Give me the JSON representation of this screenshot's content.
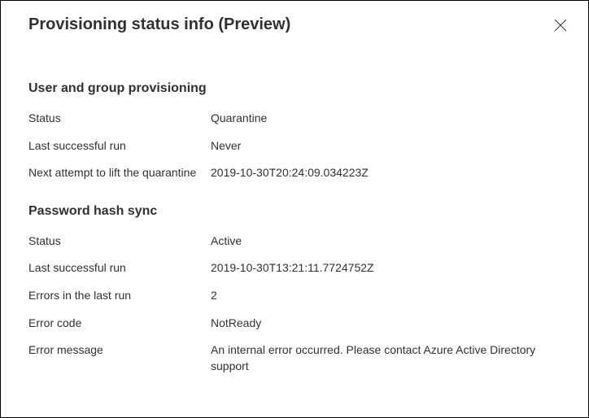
{
  "panel": {
    "title": "Provisioning status info (Preview)"
  },
  "sections": {
    "provisioning": {
      "heading": "User and group provisioning",
      "status_label": "Status",
      "status_value": "Quarantine",
      "last_run_label": "Last successful run",
      "last_run_value": "Never",
      "next_attempt_label": "Next attempt to lift the quarantine",
      "next_attempt_value": "2019-10-30T20:24:09.034223Z"
    },
    "passwordSync": {
      "heading": "Password hash sync",
      "status_label": "Status",
      "status_value": "Active",
      "last_run_label": "Last successful run",
      "last_run_value": "2019-10-30T13:21:11.7724752Z",
      "errors_label": "Errors in the last run",
      "errors_value": "2",
      "error_code_label": "Error code",
      "error_code_value": "NotReady",
      "error_message_label": "Error message",
      "error_message_value": "An internal error occurred. Please contact Azure Active Directory support"
    }
  }
}
